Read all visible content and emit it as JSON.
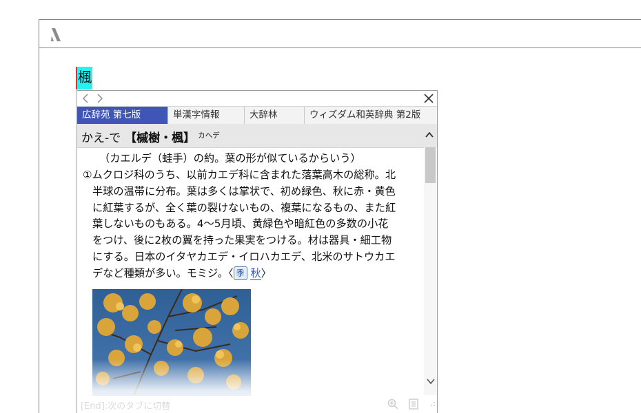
{
  "selected_word": "楓",
  "popup": {
    "tabs": [
      {
        "label": "広辞苑 第七版",
        "active": true
      },
      {
        "label": "単漢字情報",
        "active": false
      },
      {
        "label": "大辞林",
        "active": false
      },
      {
        "label": "ウィズダム和英辞典 第2版",
        "active": false
      }
    ],
    "entry": {
      "headword": "かえ-で",
      "kanji": "【槭樹・楓】",
      "kana": "カヘデ"
    },
    "body": {
      "etymology": "（カエルデ（蛙手）の約。葉の形が似ているからいう）",
      "lines": [
        "①ムクロジ科のうち、以前カエデ科に含まれた落葉高木の総称。北",
        "半球の温帯に分布。葉は多くは掌状で、初め緑色、秋に赤・黄色",
        "に紅葉するが、全く葉の裂けないもの、複葉になるもの、また紅",
        "葉しないものもある。4〜5月頃、黄緑色や暗紅色の多数の小花",
        "をつけ、後に2枚の翼を持った果実をつける。材は器具・細工物",
        "にする。日本のイタヤカエデ・イロハカエデ、北米のサトウカエ"
      ],
      "last_line_text": "デなど種類が多い。モミジ。〈",
      "season_icon": "季",
      "season_link": "秋",
      "last_line_close": "〉"
    },
    "status_text": "[End]:次のタブに切替",
    "colors": {
      "active_tab": "#4056b6",
      "highlight": "#25f3f3",
      "link": "#2a59c8"
    }
  }
}
